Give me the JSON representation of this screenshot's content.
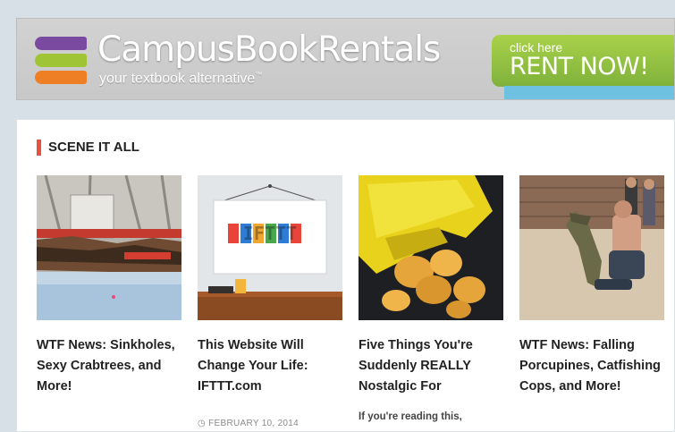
{
  "banner": {
    "brand": "CampusBookRentals",
    "tagline": "your textbook alternative",
    "tagline_mark": "™",
    "cta_small": "click here",
    "cta_big": "RENT NOW!",
    "colors": {
      "purple": "#7a4aa0",
      "green": "#9fc536",
      "orange": "#ef7f24",
      "cta": "#8cbf3f",
      "stripe": "#6fc1e1"
    }
  },
  "section": {
    "title": "SCENE IT ALL",
    "accent": "#e8503f"
  },
  "posts": [
    {
      "title": "WTF News: Sinkholes, Sexy Crabtrees, and More!",
      "meta": "",
      "excerpt": ""
    },
    {
      "title": "This Website Will Change Your Life: IFTTT.com",
      "meta": "FEBRUARY 10, 2014",
      "excerpt": "",
      "logo_text": "IFTTT"
    },
    {
      "title": "Five Things You're Suddenly REALLY Nostalgic For",
      "meta": "",
      "excerpt": "If you're reading this,"
    },
    {
      "title": "WTF News: Falling Porcupines, Catfishing Cops, and More!",
      "meta": "",
      "excerpt": ""
    }
  ]
}
